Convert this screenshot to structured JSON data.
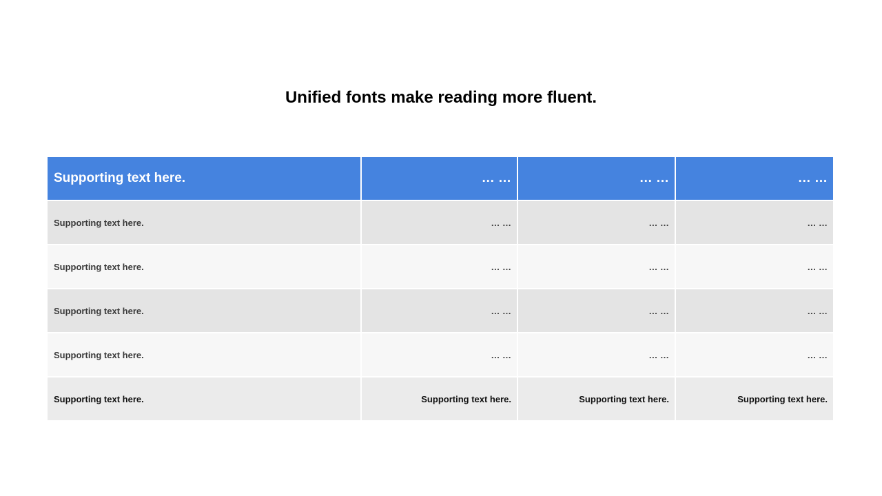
{
  "title": "Unified fonts make reading more fluent.",
  "table": {
    "header": [
      "Supporting text here.",
      "… …",
      "… …",
      "… …"
    ],
    "rows": [
      [
        "Supporting text here.",
        "… …",
        "… …",
        "… …"
      ],
      [
        "Supporting text here.",
        "… …",
        "… …",
        "… …"
      ],
      [
        "Supporting text here.",
        "… …",
        "… …",
        "… …"
      ],
      [
        "Supporting text here.",
        "… …",
        "… …",
        "… …"
      ]
    ],
    "footer": [
      "Supporting text here.",
      "Supporting text here.",
      "Supporting text here.",
      "Supporting text here."
    ]
  },
  "colors": {
    "header_bg": "#4583df",
    "row_dark": "#e4e4e4",
    "row_light": "#f7f7f7",
    "footer_bg": "#ebebeb"
  }
}
